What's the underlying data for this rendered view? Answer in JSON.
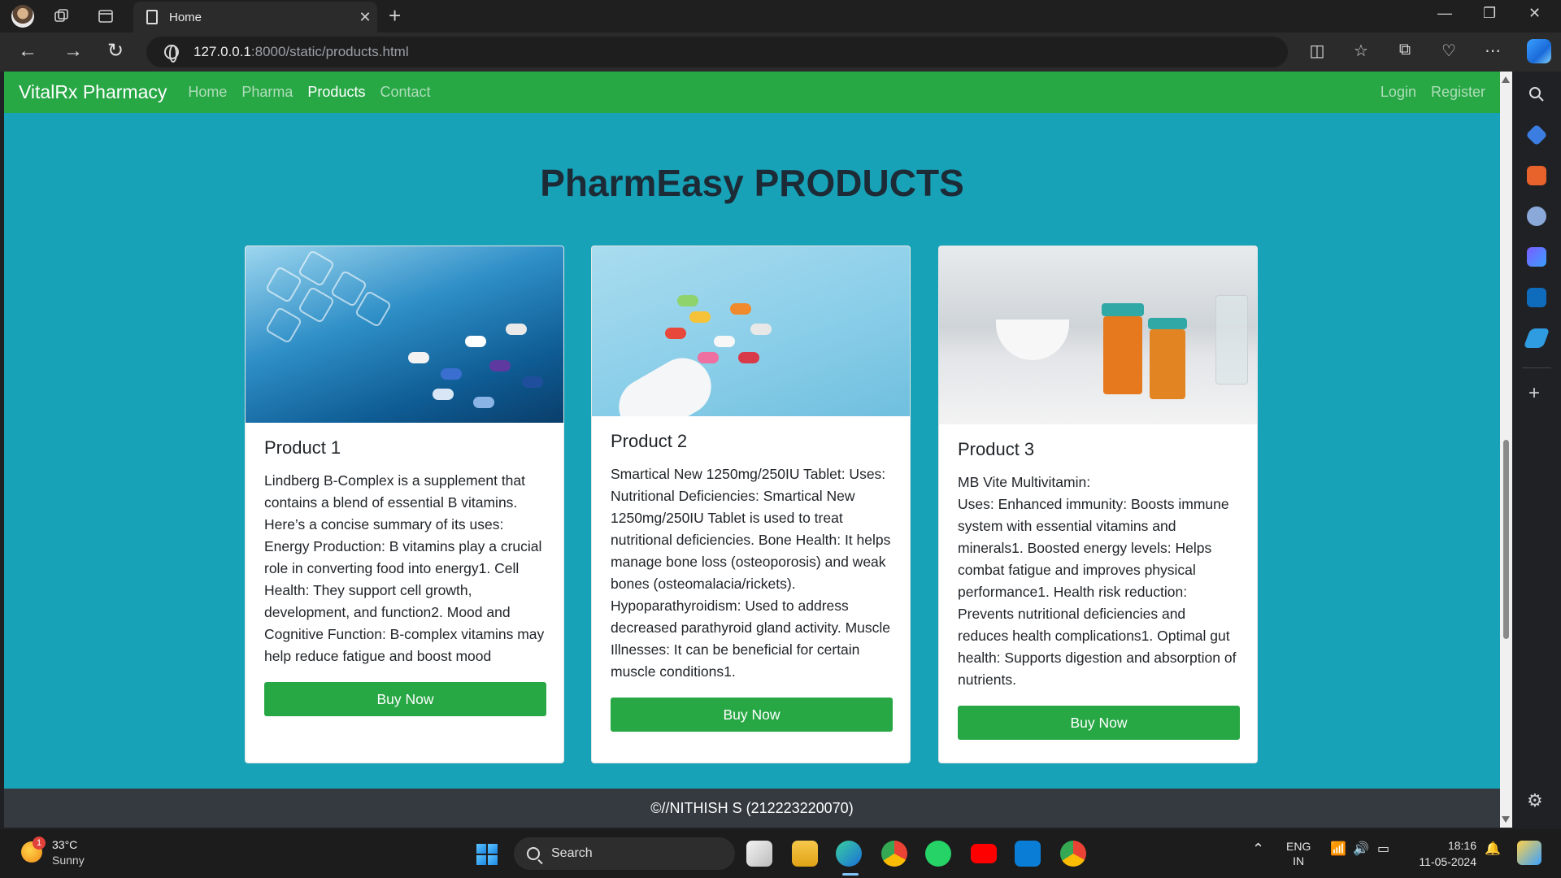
{
  "browser": {
    "tab_title": "Home",
    "url_host": "127.0.0.1",
    "url_path": ":8000/static/products.html"
  },
  "site": {
    "brand": "VitalRx Pharmacy",
    "nav": [
      {
        "label": "Home",
        "active": false
      },
      {
        "label": "Pharma",
        "active": false
      },
      {
        "label": "Products",
        "active": true
      },
      {
        "label": "Contact",
        "active": false
      }
    ],
    "nav_right": [
      {
        "label": "Login"
      },
      {
        "label": "Register"
      }
    ],
    "page_title": "PharmEasy PRODUCTS",
    "cards": [
      {
        "title": "Product 1",
        "text": "Lindberg B-Complex is a supplement that contains a blend of essential B vitamins. Here’s a concise summary of its uses: Energy Production: B vitamins play a crucial role in converting food into energy1. Cell Health: They support cell growth, development, and function2. Mood and Cognitive Function: B-complex vitamins may help reduce fatigue and boost mood",
        "button": "Buy Now"
      },
      {
        "title": "Product 2",
        "text": "Smartical New 1250mg/250IU Tablet: Uses: Nutritional Deficiencies: Smartical New 1250mg/250IU Tablet is used to treat nutritional deficiencies. Bone Health: It helps manage bone loss (osteoporosis) and weak bones (osteomalacia/rickets). Hypoparathyroidism: Used to address decreased parathyroid gland activity. Muscle Illnesses: It can be beneficial for certain muscle conditions1.",
        "button": "Buy Now"
      },
      {
        "title": "Product 3",
        "text": "MB Vite Multivitamin:\nUses: Enhanced immunity: Boosts immune system with essential vitamins and minerals1. Boosted energy levels: Helps combat fatigue and improves physical performance1. Health risk reduction: Prevents nutritional deficiencies and reduces health complications1. Optimal gut health: Supports digestion and absorption of nutrients.",
        "button": "Buy Now"
      }
    ],
    "footer": "©//NITHISH S (212223220070)"
  },
  "taskbar": {
    "weather_badge": "1",
    "temperature": "33°C",
    "condition": "Sunny",
    "search_label": "Search",
    "lang_line1": "ENG",
    "lang_line2": "IN",
    "time": "18:16",
    "date": "11-05-2024"
  },
  "colors": {
    "navbar": "#28a745",
    "page_bg": "#17a2b8",
    "footer": "#343a40",
    "button": "#28a745"
  }
}
